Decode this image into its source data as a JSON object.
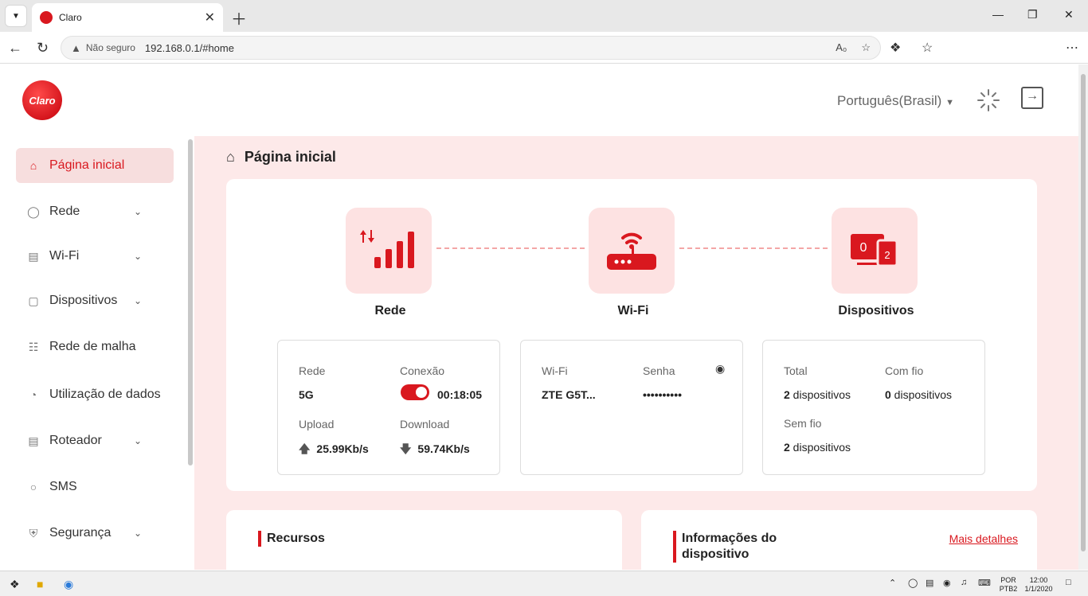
{
  "browser": {
    "tab_title": "Claro",
    "not_secure": "Não seguro",
    "url": "192.168.0.1/#home"
  },
  "header": {
    "logo_text": "Claro",
    "language": "Português(Brasil)"
  },
  "sidebar": {
    "items": [
      {
        "label": "Página inicial",
        "icon": "home-icon",
        "active": true
      },
      {
        "label": "Rede",
        "icon": "globe-icon"
      },
      {
        "label": "Wi-Fi",
        "icon": "router-icon"
      },
      {
        "label": "Dispositivos",
        "icon": "devices-icon"
      },
      {
        "label": "Rede de malha",
        "icon": "mesh-icon"
      },
      {
        "label": "Utilização de dados",
        "icon": "pie-icon"
      },
      {
        "label": "Roteador",
        "icon": "router-icon"
      },
      {
        "label": "SMS",
        "icon": "chat-icon"
      },
      {
        "label": "Segurança",
        "icon": "shield-icon"
      }
    ]
  },
  "main": {
    "title": "Página inicial",
    "rede": {
      "caption": "Rede",
      "rede_label": "Rede",
      "rede_value": "5G",
      "conexao_label": "Conexão",
      "conexao_time": "00:18:05",
      "upload_label": "Upload",
      "upload_value": "25.99Kb/s",
      "download_label": "Download",
      "download_value": "59.74Kb/s"
    },
    "wifi": {
      "caption": "Wi-Fi",
      "wifi_label": "Wi-Fi",
      "wifi_value": "ZTE G5T...",
      "senha_label": "Senha",
      "senha_value": "••••••••••"
    },
    "devices": {
      "caption": "Dispositivos",
      "icon_wired": "0",
      "icon_wireless": "2",
      "total_label": "Total",
      "total_num": "2",
      "total_unit": " dispositivos",
      "comfio_label": "Com fio",
      "comfio_num": "0",
      "comfio_unit": " dispositivos",
      "semfio_label": "Sem fio",
      "semfio_num": "2",
      "semfio_unit": " dispositivos"
    },
    "recursos_title": "Recursos",
    "info_title_1": "Informações do",
    "info_title_2": "dispositivo",
    "mais_detalhes": "Mais detalhes"
  },
  "taskbar": {
    "lang_top": "POR",
    "lang_bottom": "PTB2",
    "time": "12:00",
    "date": "1/1/2020"
  },
  "colors": {
    "accent": "#d9181f",
    "bg_pink": "#fde9e9"
  }
}
